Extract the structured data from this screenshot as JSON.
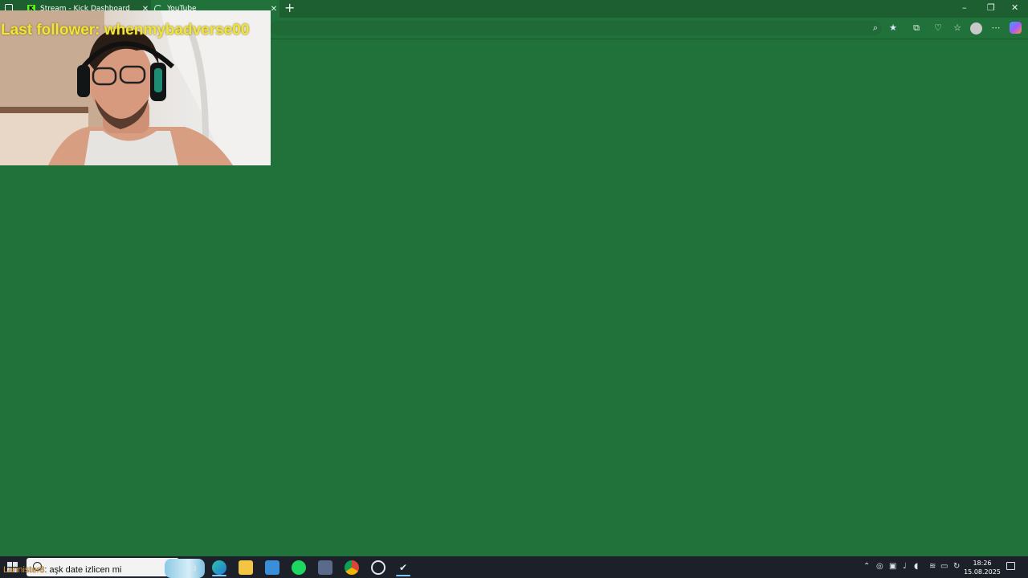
{
  "browser": {
    "tabs": [
      {
        "title": "Stream - Kick Dashboard",
        "icon": "kick-icon",
        "active": false
      },
      {
        "title": "YouTube",
        "icon": "youtube-loading-icon",
        "active": true
      }
    ],
    "close_glyph": "✕",
    "new_tab_glyph": "+",
    "window_controls": {
      "minimize": "–",
      "restore": "❐",
      "close": "✕"
    },
    "toolbar_icons": [
      "zoom-icon",
      "favorite-star-icon",
      "extensions-icon",
      "browser-essentials-icon",
      "favorites-icon",
      "profile-avatar",
      "more-icon",
      "copilot-icon"
    ]
  },
  "overlay": {
    "follower_text": "Last follower: whenmybadverse00"
  },
  "chat": {
    "user": "Lannister8",
    "message": ": aşk date izlicen mi"
  },
  "taskbar": {
    "apps": [
      "task-view-icon",
      "edge-icon",
      "file-explorer-icon",
      "mail-icon",
      "spotify-icon",
      "calculator-icon",
      "chrome-icon",
      "obs-icon",
      "steam-icon"
    ],
    "active_app": "steam-icon",
    "tray_icons": [
      "chevron-up-icon",
      "vpn-icon",
      "display-icon",
      "mic-icon",
      "volume-icon",
      "wifi-icon",
      "battery-icon",
      "sync-icon"
    ],
    "time": "18:26",
    "date": "15.08.2025"
  },
  "colors": {
    "page_background": "#21713a",
    "follower_text": "#f1e43a",
    "chat_user": "#e6a33a"
  }
}
